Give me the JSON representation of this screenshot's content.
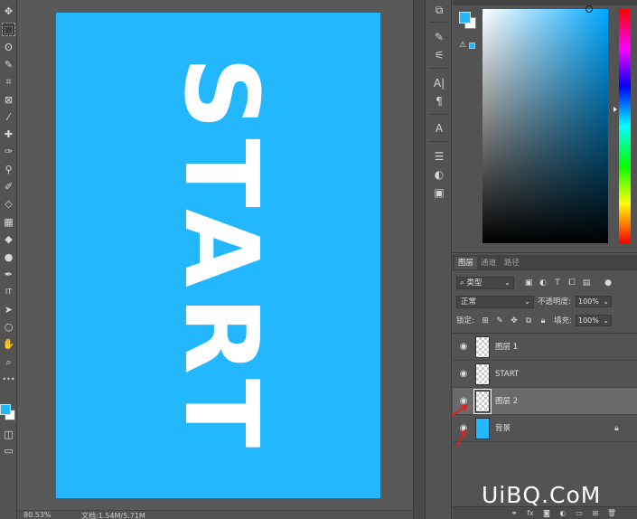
{
  "toolbar": {
    "tools": [
      {
        "name": "move-tool-icon",
        "glyph": "✥"
      },
      {
        "name": "marquee-tool-icon",
        "glyph": "⬚"
      },
      {
        "name": "lasso-tool-icon",
        "glyph": "ʘ"
      },
      {
        "name": "quick-select-tool-icon",
        "glyph": "✎"
      },
      {
        "name": "crop-tool-icon",
        "glyph": "⌗"
      },
      {
        "name": "frame-tool-icon",
        "glyph": "⊠"
      },
      {
        "name": "eyedropper-tool-icon",
        "glyph": "⁄"
      },
      {
        "name": "healing-brush-tool-icon",
        "glyph": "✚"
      },
      {
        "name": "brush-tool-icon",
        "glyph": "✑"
      },
      {
        "name": "clone-stamp-tool-icon",
        "glyph": "⚲"
      },
      {
        "name": "history-brush-tool-icon",
        "glyph": "✐"
      },
      {
        "name": "eraser-tool-icon",
        "glyph": "◇"
      },
      {
        "name": "gradient-tool-icon",
        "glyph": "▦"
      },
      {
        "name": "blur-tool-icon",
        "glyph": "◆"
      },
      {
        "name": "dodge-tool-icon",
        "glyph": "●"
      },
      {
        "name": "pen-tool-icon",
        "glyph": "✒"
      },
      {
        "name": "type-tool-icon",
        "glyph": "IT"
      },
      {
        "name": "path-select-tool-icon",
        "glyph": "➤"
      },
      {
        "name": "shape-tool-icon",
        "glyph": "○"
      },
      {
        "name": "hand-tool-icon",
        "glyph": "✋"
      },
      {
        "name": "zoom-tool-icon",
        "glyph": "⌕"
      },
      {
        "name": "more-tools-icon",
        "glyph": "•••"
      }
    ],
    "foreground_color": "#22b7fe",
    "background_color": "#ffffff"
  },
  "canvas": {
    "background_color": "#22b7fe",
    "text": "START"
  },
  "status": {
    "zoom": "80.53%",
    "doc_info": "文档:1.54M/5.71M"
  },
  "color_panel": {
    "current_color": "#22b7fe"
  },
  "layers_panel": {
    "tabs": [
      "图层",
      "通道",
      "路径"
    ],
    "filter_label": "类型",
    "blend_mode": "正常",
    "opacity_label": "不透明度:",
    "opacity_value": "100%",
    "lock_label": "锁定:",
    "fill_label": "填充:",
    "fill_value": "100%",
    "layers": [
      {
        "name": "图层 1",
        "thumb": "transparent",
        "selected": false,
        "locked": false
      },
      {
        "name": "START",
        "thumb": "transparent",
        "selected": false,
        "locked": false
      },
      {
        "name": "图层 2",
        "thumb": "transparent",
        "selected": true,
        "locked": false
      },
      {
        "name": "背景",
        "thumb": "blue",
        "selected": false,
        "locked": true
      }
    ]
  },
  "watermark": "UiBQ.CoM"
}
